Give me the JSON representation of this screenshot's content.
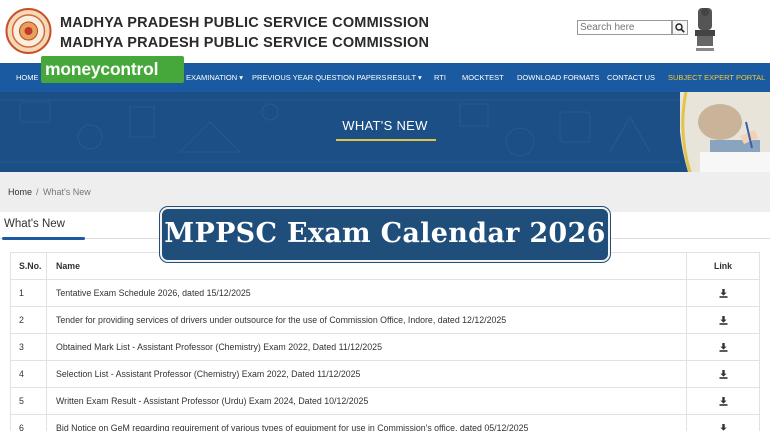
{
  "header": {
    "title_line1": "MADHYA PRADESH PUBLIC SERVICE COMMISSION",
    "title_line2": "MADHYA PRADESH PUBLIC SERVICE COMMISSION",
    "search_placeholder": "Search here"
  },
  "nav": {
    "items": [
      {
        "label": "HOME"
      },
      {
        "label": "EXAMINATION ▾"
      },
      {
        "label": "PREVIOUS YEAR QUESTION PAPERS"
      },
      {
        "label": "RESULT ▾"
      },
      {
        "label": "RTI"
      },
      {
        "label": "MOCKTEST"
      },
      {
        "label": "DOWNLOAD FORMATS"
      },
      {
        "label": "CONTACT US"
      },
      {
        "label": "SUBJECT EXPERT PORTAL"
      }
    ],
    "highlight_color": "#f4c63b"
  },
  "watermark": {
    "brand": "moneycontrol"
  },
  "banner": {
    "title": "WHAT'S NEW"
  },
  "breadcrumb": {
    "home": "Home",
    "separator": "/",
    "current": "What's New"
  },
  "section": {
    "title": "What's New"
  },
  "overlay": {
    "text": "MPPSC Exam Calendar 2026"
  },
  "table": {
    "headers": {
      "sno": "S.No.",
      "name": "Name",
      "link": "Link"
    },
    "rows": [
      {
        "sno": "1",
        "name": "Tentative Exam Schedule 2026, dated 15/12/2025"
      },
      {
        "sno": "2",
        "name": "Tender for providing services of drivers under outsource for the use of Commission Office, Indore, dated 12/12/2025"
      },
      {
        "sno": "3",
        "name": "Obtained Mark List - Assistant Professor (Chemistry) Exam 2022, Dated 11/12/2025"
      },
      {
        "sno": "4",
        "name": "Selection List - Assistant Professor (Chemistry) Exam 2022, Dated 11/12/2025"
      },
      {
        "sno": "5",
        "name": "Written Exam Result - Assistant Professor (Urdu) Exam 2024, Dated 10/12/2025"
      },
      {
        "sno": "6",
        "name": "Bid Notice on GeM regarding requirement of various types of equipment for use in Commission's office, dated 05/12/2025"
      }
    ]
  },
  "colors": {
    "nav_bg": "#1a5aa0",
    "banner_bg": "#1b4f86",
    "overlay_bg": "#1f4e7a",
    "brand_green": "#46a83a"
  }
}
